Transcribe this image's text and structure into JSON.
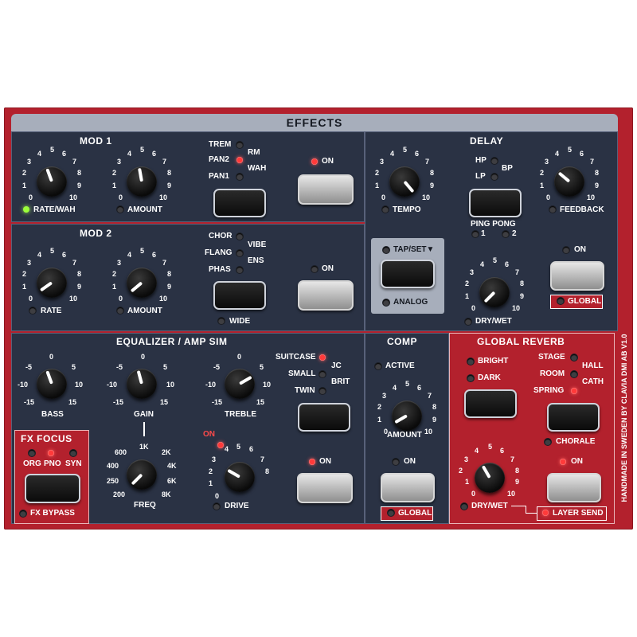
{
  "header": {
    "title": "EFFECTS"
  },
  "mod1": {
    "title": "MOD 1",
    "knob_scale": [
      "0",
      "1",
      "2",
      "3",
      "4",
      "5",
      "6",
      "7",
      "8",
      "9",
      "10"
    ],
    "rate_label": "RATE/WAH",
    "amount_label": "AMOUNT",
    "types": [
      "TREM",
      "PAN2",
      "PAN1",
      "RM",
      "WAH"
    ],
    "on_label": "ON"
  },
  "mod2": {
    "title": "MOD 2",
    "knob_scale": [
      "0",
      "1",
      "2",
      "3",
      "4",
      "5",
      "6",
      "7",
      "8",
      "9",
      "10"
    ],
    "rate_label": "RATE",
    "amount_label": "AMOUNT",
    "types": [
      "CHOR",
      "FLANG",
      "PHAS",
      "VIBE",
      "ENS"
    ],
    "wide_label": "WIDE",
    "on_label": "ON"
  },
  "delay": {
    "title": "DELAY",
    "knob_scale": [
      "0",
      "1",
      "2",
      "3",
      "4",
      "5",
      "6",
      "7",
      "8",
      "9",
      "10"
    ],
    "tempo_label": "TEMPO",
    "feedback_label": "FEEDBACK",
    "filters": [
      "HP",
      "LP",
      "BP"
    ],
    "ping_pong_label": "PING PONG",
    "ping_pong_options": [
      "1",
      "2"
    ],
    "tap_set_label": "TAP/SET▼",
    "analog_label": "ANALOG",
    "dry_wet_label": "DRY/WET",
    "on_label": "ON",
    "global_label": "GLOBAL"
  },
  "eq": {
    "title": "EQUALIZER / AMP SIM",
    "band_scale": [
      "-15",
      "-10",
      "-5",
      "0",
      "5",
      "10",
      "15"
    ],
    "bass_label": "BASS",
    "gain_label": "GAIN",
    "treble_label": "TREBLE",
    "freq_scale": [
      "200",
      "250",
      "400",
      "600",
      "1K",
      "2K",
      "4K",
      "6K",
      "8K"
    ],
    "freq_label": "FREQ",
    "drive_on_label": "ON",
    "drive_scale": [
      "0",
      "1",
      "2",
      "3",
      "4",
      "5",
      "6",
      "7",
      "8"
    ],
    "drive_label": "DRIVE",
    "amp_types": [
      "SUITCASE",
      "SMALL",
      "TWIN",
      "JC",
      "BRIT"
    ],
    "on_label": "ON"
  },
  "fx_focus": {
    "title": "FX FOCUS",
    "options": [
      "ORG",
      "PNO",
      "SYN"
    ],
    "bypass_label": "FX BYPASS"
  },
  "comp": {
    "title": "COMP",
    "active_label": "ACTIVE",
    "knob_scale": [
      "0",
      "1",
      "2",
      "3",
      "4",
      "5",
      "6",
      "7",
      "8",
      "9",
      "10"
    ],
    "amount_label": "AMOUNT",
    "on_label": "ON",
    "global_label": "GLOBAL"
  },
  "reverb": {
    "title": "GLOBAL REVERB",
    "bright_label": "BRIGHT",
    "dark_label": "DARK",
    "types": [
      "STAGE",
      "ROOM",
      "SPRING",
      "HALL",
      "CATH"
    ],
    "chorale_label": "CHORALE",
    "knob_scale": [
      "0",
      "1",
      "2",
      "3",
      "4",
      "5",
      "6",
      "7",
      "8",
      "9",
      "10"
    ],
    "dry_wet_label": "DRY/WET",
    "on_label": "ON",
    "layer_send_label": "LAYER SEND"
  },
  "side_text": "HANDMADE IN SWEDEN BY CLAVIA DMI AB  V1.0",
  "colors": {
    "panel_red": "#b3212d",
    "section_navy": "#2a3244",
    "header_gray": "#a7aebb",
    "led_red": "#ff3a3a",
    "led_green": "#9cff3a"
  }
}
